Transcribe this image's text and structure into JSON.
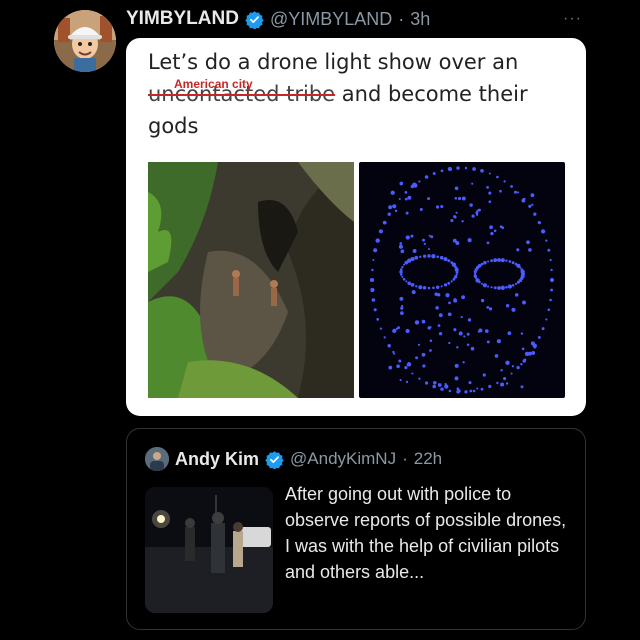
{
  "post": {
    "display_name": "YIMBYLAND",
    "handle": "@YIMBYLAND",
    "separator": "·",
    "time": "3h",
    "verified_icon": "verified-badge-icon",
    "more_icon": "more-options-icon",
    "more_glyph": "···"
  },
  "meme": {
    "line1": "Let’s do a drone light show over an",
    "struck_text": "uncontacted tribe",
    "inserted_text": "American city",
    "line2_rest": " and become their",
    "line3": "gods",
    "left_image": "aerial-photo-forest-clearing",
    "right_image": "drone-light-show-face"
  },
  "quoted_post": {
    "display_name": "Andy Kim",
    "handle": "@AndyKimNJ",
    "separator": "·",
    "time": "22h",
    "text": "After going out with police to observe reports of possible drones, I was with the help of civilian pilots and others able...",
    "thumbnail": "night-photo-people-roadside"
  },
  "colors": {
    "background": "#000000",
    "verified_blue": "#1d9bf0",
    "strike_red": "#c62828",
    "drone_blue": "#4b5cff"
  }
}
